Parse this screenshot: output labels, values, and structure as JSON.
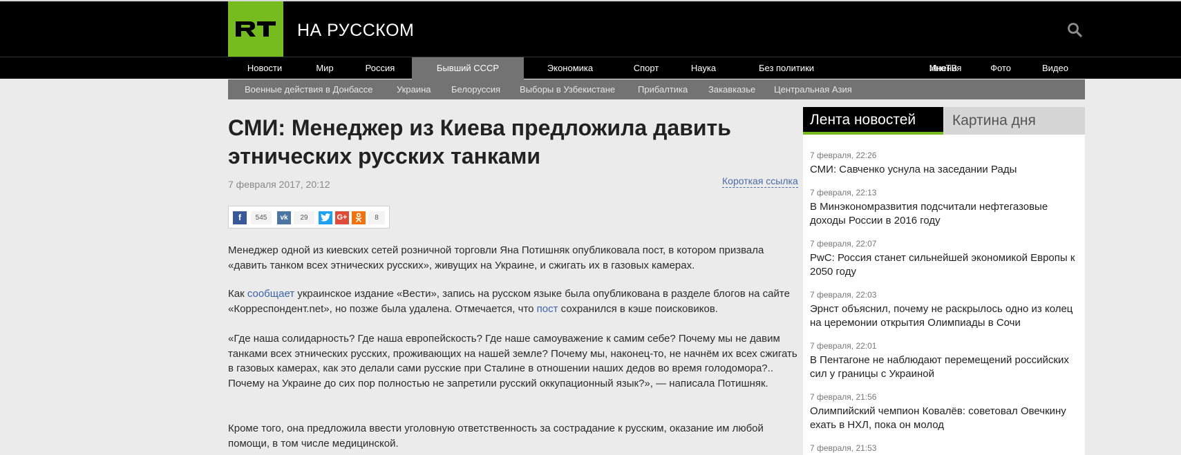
{
  "header": {
    "logo_text": "RT",
    "brand": "НА РУССКОМ",
    "search_icon": "search-icon"
  },
  "main_nav": [
    "Новости",
    "Мир",
    "Россия",
    "Бывший СССР",
    "Экономика",
    "Спорт",
    "Наука",
    "Без политики",
    "Мнения",
    "ИноТВ",
    "Фото",
    "Видео"
  ],
  "main_nav_active": "Бывший СССР",
  "sub_nav": [
    "Военные действия в Донбассе",
    "Украина",
    "Белоруссия",
    "Выборы в Узбекистане",
    "Прибалтика",
    "Закавказье",
    "Центральная Азия"
  ],
  "article": {
    "title": "СМИ: Менеджер из Киева предложила давить этнических русских танками",
    "date": "7 февраля 2017, 20:12",
    "short_link": "Короткая ссылка",
    "share": {
      "facebook_icon": "f",
      "facebook_count": "545",
      "vk_icon": "vk",
      "vk_count": "29",
      "twitter_icon": "twitter-icon",
      "google_icon": "G+",
      "ok_icon": "ok-icon",
      "ok_count": "8"
    },
    "p1": "Менеджер одной из киевских сетей розничной торговли Яна Потишняк опубликовала пост, в котором призвала «давить танком всех этнических русских», живущих на Украине, и сжигать их в газовых камерах.",
    "p2_before": "Как ",
    "p2_link1": "сообщает",
    "p2_middle": " украинское издание «Вести», запись на русском языке была опубликована в разделе блогов на сайте «Корреспондент.net», но позже была удалена. Отмечается, что ",
    "p2_link2": "пост",
    "p2_after": " сохранился в кэше поисковиков.",
    "p3": "«Где наша солидарность? Где наша европейскость? Где наше самоуважение к самим себе? Почему мы не давим танками всех этнических русских, проживающих на нашей земле? Почему мы, наконец-то, не начнём их всех сжигать в газовых камерах, как это делали сами русские при Сталине в отношении наших дедов во время голодомора?.. Почему на Украине до сих пор полностью не запретили русский оккупационный язык?», — написала Потишняк.",
    "p4": "Кроме того, она предложила ввести уголовную ответственность за сострадание к русским, оказание им любой помощи, в том числе медицинской."
  },
  "sidebar": {
    "tab_feed": "Лента новостей",
    "tab_day": "Картина дня",
    "items": [
      {
        "time": "7 февраля, 22:26",
        "title": "СМИ: Савченко уснула на заседании Рады"
      },
      {
        "time": "7 февраля, 22:13",
        "title": "В Минэкономразвития подсчитали нефтегазовые доходы России в 2016 году"
      },
      {
        "time": "7 февраля, 22:07",
        "title": "PwC: Россия станет сильнейшей экономикой Европы к 2050 году"
      },
      {
        "time": "7 февраля, 22:03",
        "title": "Эрнст объяснил, почему не раскрылось одно из колец на церемонии открытия Олимпиады в Сочи"
      },
      {
        "time": "7 февраля, 22:01",
        "title": "В Пентагоне не наблюдают перемещений российских сил у границы с Украиной"
      },
      {
        "time": "7 февраля, 21:56",
        "title": "Олимпийский чемпион Ковалёв: советовал Овечкину ехать в НХЛ, пока он молод"
      },
      {
        "time": "7 февраля, 21:53",
        "title": ""
      }
    ]
  },
  "colors": {
    "accent": "#77bc1f",
    "header_bg": "#000000",
    "subnav_bg": "#737373",
    "link": "#3a63a8",
    "page_bg": "#ebebeb"
  }
}
